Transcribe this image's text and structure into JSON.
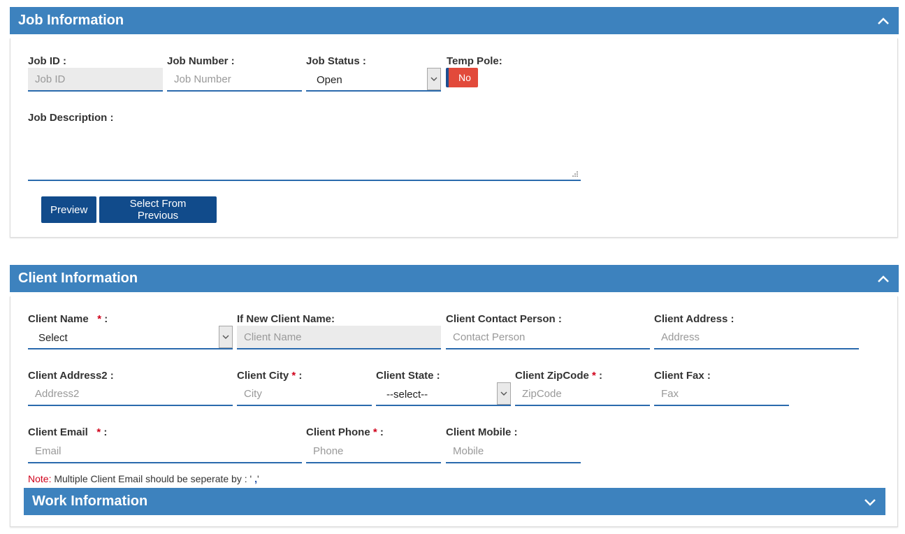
{
  "job": {
    "title": "Job Information",
    "job_id_label": "Job ID :",
    "job_id_placeholder": "Job ID",
    "job_number_label": "Job Number :",
    "job_number_placeholder": "Job Number",
    "job_status_label": "Job Status :",
    "job_status_value": "Open",
    "temp_pole_label": "Temp Pole:",
    "temp_pole_value": "No",
    "description_label": "Job Description :",
    "preview_label": "Preview",
    "select_previous_label": "Select From Previous"
  },
  "client": {
    "title": "Client Information",
    "name_label": "Client Name",
    "name_value": "Select",
    "new_name_label": "If New Client Name:",
    "new_name_placeholder": "Client Name",
    "contact_label": "Client Contact Person :",
    "contact_placeholder": "Contact Person",
    "address_label": "Client Address :",
    "address_placeholder": "Address",
    "address2_label": "Client Address2 :",
    "address2_placeholder": "Address2",
    "city_label": "Client City",
    "city_placeholder": "City",
    "state_label": "Client State :",
    "state_value": "--select--",
    "zip_label": "Client ZipCode",
    "zip_placeholder": "ZipCode",
    "fax_label": "Client Fax :",
    "fax_placeholder": "Fax",
    "email_label": "Client Email",
    "email_placeholder": "Email",
    "phone_label": "Client Phone",
    "phone_placeholder": "Phone",
    "mobile_label": "Client Mobile :",
    "mobile_placeholder": "Mobile",
    "required_mark": "*",
    "colon": ":",
    "note_key": "Note:",
    "note_text": " Multiple Client Email should be seperate by : '",
    "note_comma": " ,",
    "note_end": "'"
  },
  "work": {
    "title": "Work Information"
  },
  "colors": {
    "header": "#3d82be",
    "button": "#114b8b",
    "toggle_off": "#e24a3b",
    "field_underline": "#2a6aad",
    "required": "#d0021b"
  },
  "icons": {
    "collapse": "chevron-up-icon",
    "expand": "chevron-down-icon",
    "select_arrow": "chevron-down-icon",
    "resize": "resize-grip-icon"
  }
}
